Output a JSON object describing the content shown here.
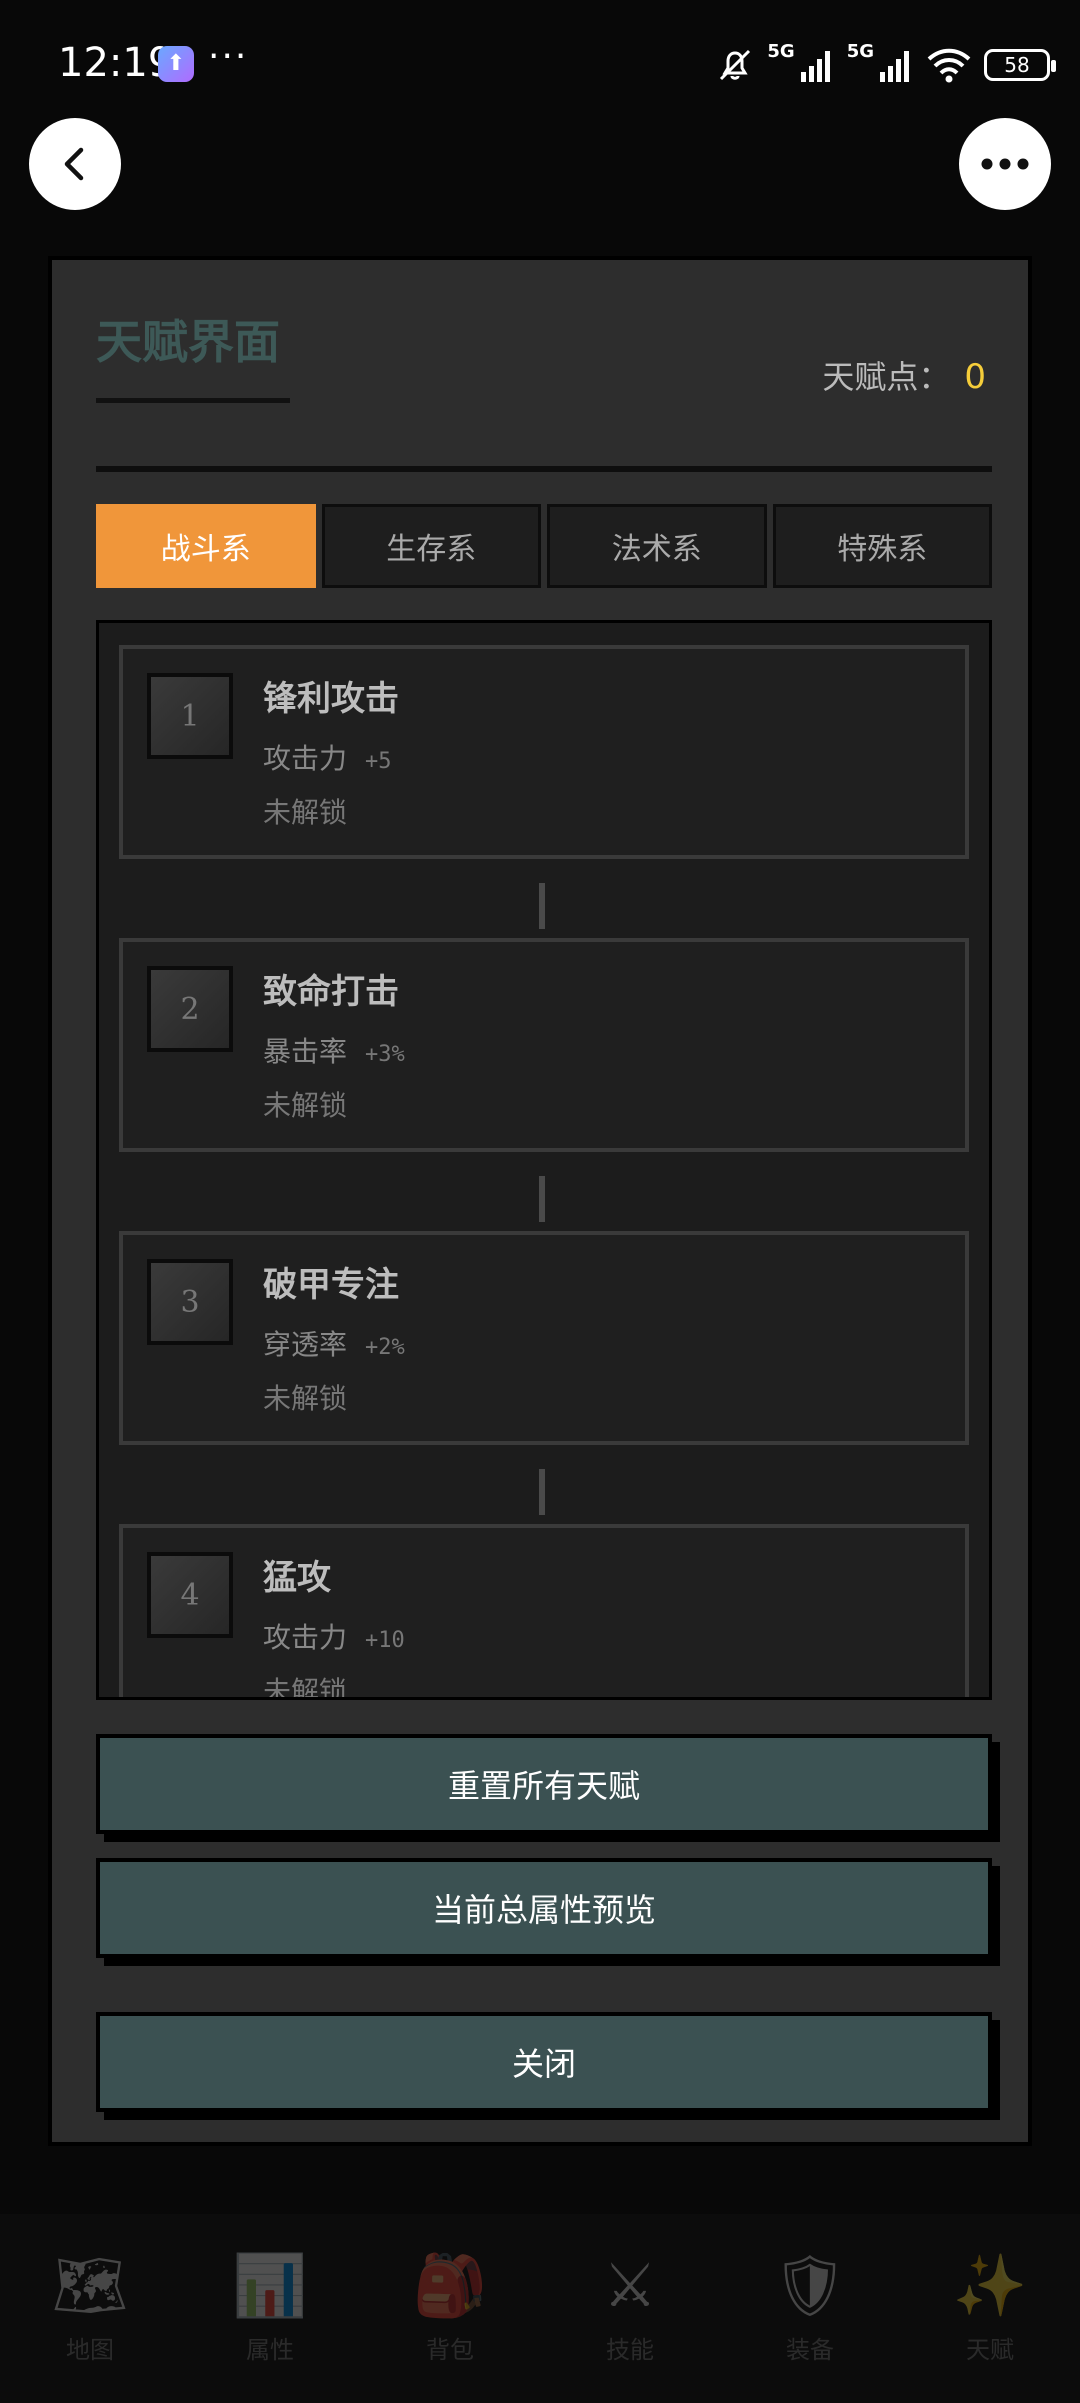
{
  "status_bar": {
    "time": "12:19",
    "dots": "···",
    "signal1_label": "5G",
    "signal2_label": "5G",
    "battery": "58"
  },
  "panel": {
    "title": "天赋界面",
    "points_label": "天赋点：",
    "points_value": "0",
    "tabs": [
      {
        "label": "战斗系",
        "active": true
      },
      {
        "label": "生存系",
        "active": false
      },
      {
        "label": "法术系",
        "active": false
      },
      {
        "label": "特殊系",
        "active": false
      }
    ],
    "talents": [
      {
        "num": "1",
        "name": "锋利攻击",
        "stat": "攻击力",
        "bonus": "+5",
        "status": "未解锁"
      },
      {
        "num": "2",
        "name": "致命打击",
        "stat": "暴击率",
        "bonus": "+3%",
        "status": "未解锁"
      },
      {
        "num": "3",
        "name": "破甲专注",
        "stat": "穿透率",
        "bonus": "+2%",
        "status": "未解锁"
      },
      {
        "num": "4",
        "name": "猛攻",
        "stat": "攻击力",
        "bonus": "+10",
        "status": "未解锁"
      }
    ],
    "buttons": {
      "reset": "重置所有天赋",
      "preview": "当前总属性预览",
      "close": "关闭"
    }
  },
  "bottom_nav": [
    {
      "label": "地图",
      "icon": "map-icon"
    },
    {
      "label": "属性",
      "icon": "chart-icon"
    },
    {
      "label": "背包",
      "icon": "backpack-icon"
    },
    {
      "label": "技能",
      "icon": "swords-icon"
    },
    {
      "label": "装备",
      "icon": "shield-icon"
    },
    {
      "label": "天赋",
      "icon": "sparkles-icon"
    }
  ],
  "colors": {
    "accent": "#f0963a",
    "button": "#3b5152",
    "points": "#f5cd3a",
    "title": "#3d5957"
  }
}
